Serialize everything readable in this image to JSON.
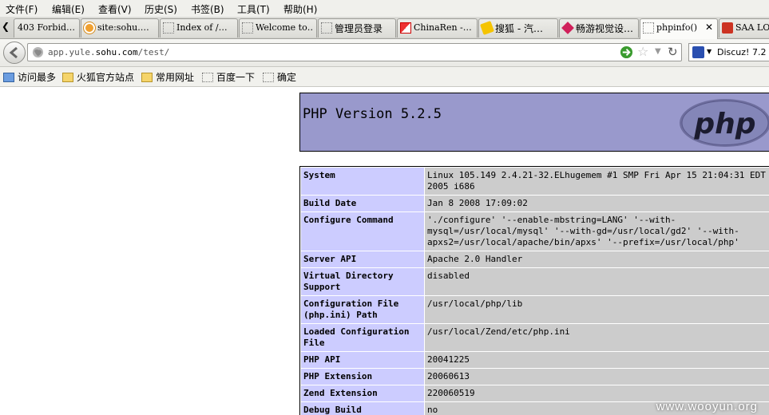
{
  "menu": [
    "文件(F)",
    "编辑(E)",
    "查看(V)",
    "历史(S)",
    "书签(B)",
    "工具(T)",
    "帮助(H)"
  ],
  "tabs": [
    {
      "title": "403 Forbid…",
      "icon": "blank-page-icon"
    },
    {
      "title": "site:sohu.…",
      "icon": "baidu-icon"
    },
    {
      "title": "Index of /…",
      "icon": "blank-page-icon"
    },
    {
      "title": "Welcome to…",
      "icon": "blank-page-icon"
    },
    {
      "title": "管理员登录",
      "icon": "blank-page-icon"
    },
    {
      "title": "ChinaRen -…",
      "icon": "chinaren-icon"
    },
    {
      "title": "搜狐 - 汽…",
      "icon": "sohu-icon"
    },
    {
      "title": "畅游视觉设…",
      "icon": "changyou-icon"
    },
    {
      "title": "phpinfo()",
      "icon": "blank-page-icon",
      "active": true
    },
    {
      "title": "SAA LOG",
      "icon": "saa-icon"
    }
  ],
  "url": {
    "prefix": "app.yule.",
    "domain": "sohu.com",
    "path": "/test/"
  },
  "search": {
    "text": "Discuz! 7.2"
  },
  "bookmarks": [
    {
      "label": "访问最多",
      "icon": "smart-folder-icon"
    },
    {
      "label": "火狐官方站点",
      "icon": "folder-icon"
    },
    {
      "label": "常用网址",
      "icon": "folder-icon"
    },
    {
      "label": "百度一下",
      "icon": "blank-page-icon"
    },
    {
      "label": "确定",
      "icon": "blank-page-icon"
    }
  ],
  "php": {
    "version_title": "PHP Version 5.2.5",
    "logo_text": "php",
    "rows": [
      {
        "key": "System",
        "value": "Linux 105.149 2.4.21-32.ELhugemem #1 SMP Fri Apr 15 21:04:31 EDT 2005 i686"
      },
      {
        "key": "Build Date",
        "value": "Jan 8 2008 17:09:02"
      },
      {
        "key": "Configure Command",
        "value": "'./configure' '--enable-mbstring=LANG' '--with-mysql=/usr/local/mysql' '--with-gd=/usr/local/gd2' '--with-apxs2=/usr/local/apache/bin/apxs' '--prefix=/usr/local/php'"
      },
      {
        "key": "Server API",
        "value": "Apache 2.0 Handler"
      },
      {
        "key": "Virtual Directory Support",
        "value": "disabled"
      },
      {
        "key": "Configuration File (php.ini) Path",
        "value": "/usr/local/php/lib"
      },
      {
        "key": "Loaded Configuration File",
        "value": "/usr/local/Zend/etc/php.ini"
      },
      {
        "key": "PHP API",
        "value": "20041225"
      },
      {
        "key": "PHP Extension",
        "value": "20060613"
      },
      {
        "key": "Zend Extension",
        "value": "220060519"
      },
      {
        "key": "Debug Build",
        "value": "no"
      }
    ]
  },
  "watermark": "www.wooyun.org",
  "colors": {
    "php_header": "#9999cc",
    "key_cell": "#ccccff",
    "value_cell": "#cccccc"
  }
}
